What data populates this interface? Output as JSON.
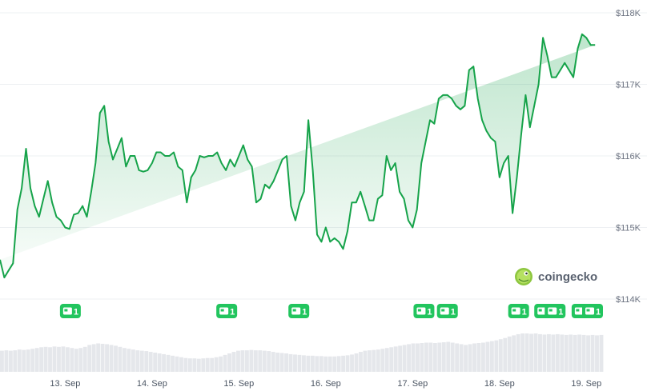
{
  "chart_data": {
    "type": "area",
    "ylim": [
      114000,
      118000
    ],
    "y_ticks": [
      {
        "value": 118000,
        "label": "$118K"
      },
      {
        "value": 117000,
        "label": "$117K"
      },
      {
        "value": 116000,
        "label": "$116K"
      },
      {
        "value": 115000,
        "label": "$115K"
      },
      {
        "value": 114000,
        "label": "$114K"
      }
    ],
    "x_ticks": [
      "13. Sep",
      "14. Sep",
      "15. Sep",
      "16. Sep",
      "17. Sep",
      "18. Sep",
      "19. Sep"
    ],
    "x_tick_days": [
      13,
      14,
      15,
      16,
      17,
      18,
      19
    ],
    "x_range_days": [
      12.25,
      19.2
    ],
    "grid": true,
    "colors": {
      "line": "#16a34a",
      "area": "#16a34a",
      "volume": "#e5e7eb",
      "badge": "#22c55e"
    },
    "series": [
      {
        "x_days": [
          12.25,
          12.3,
          12.35,
          12.4,
          12.45,
          12.5,
          12.55,
          12.6,
          12.65,
          12.7,
          12.75,
          12.8,
          12.85,
          12.9,
          12.95,
          13.0,
          13.05,
          13.1,
          13.15,
          13.2,
          13.25,
          13.3,
          13.35,
          13.4,
          13.45,
          13.5,
          13.55,
          13.6,
          13.65,
          13.7,
          13.75,
          13.8,
          13.85,
          13.9,
          13.95,
          14.0,
          14.05,
          14.1,
          14.15,
          14.2,
          14.25,
          14.3,
          14.35,
          14.4,
          14.45,
          14.5,
          14.55,
          14.6,
          14.65,
          14.7,
          14.75,
          14.8,
          14.85,
          14.9,
          14.95,
          15.0,
          15.05,
          15.1,
          15.15,
          15.2,
          15.25,
          15.3,
          15.35,
          15.4,
          15.45,
          15.5,
          15.55,
          15.6,
          15.65,
          15.7,
          15.75,
          15.8,
          15.85,
          15.9,
          15.95,
          16.0,
          16.05,
          16.1,
          16.15,
          16.2,
          16.25,
          16.3,
          16.35,
          16.4,
          16.45,
          16.5,
          16.55,
          16.6,
          16.65,
          16.7,
          16.75,
          16.8,
          16.85,
          16.9,
          16.95,
          17.0,
          17.05,
          17.1,
          17.15,
          17.2,
          17.25,
          17.3,
          17.35,
          17.4,
          17.45,
          17.5,
          17.55,
          17.6,
          17.65,
          17.7,
          17.75,
          17.8,
          17.85,
          17.9,
          17.95,
          18.0,
          18.05,
          18.1,
          18.15,
          18.2,
          18.25,
          18.3,
          18.35,
          18.4,
          18.45,
          18.5,
          18.55,
          18.6,
          18.65,
          18.7,
          18.75,
          18.8,
          18.85,
          18.9,
          18.95,
          19.0,
          19.05,
          19.1,
          19.15,
          19.2
        ],
        "values": [
          114550,
          114300,
          114400,
          114500,
          115250,
          115550,
          116100,
          115550,
          115300,
          115150,
          115400,
          115650,
          115350,
          115150,
          115100,
          115000,
          114980,
          115180,
          115200,
          115300,
          115150,
          115500,
          115900,
          116600,
          116700,
          116200,
          115950,
          116100,
          116250,
          115850,
          116000,
          116000,
          115800,
          115780,
          115800,
          115900,
          116050,
          116050,
          116000,
          116000,
          116050,
          115850,
          115800,
          115350,
          115700,
          115800,
          116000,
          115980,
          116000,
          116000,
          116050,
          115900,
          115800,
          115950,
          115850,
          116000,
          116150,
          115950,
          115850,
          115350,
          115400,
          115600,
          115550,
          115650,
          115800,
          115950,
          116000,
          115300,
          115100,
          115350,
          115500,
          116500,
          115800,
          114900,
          114800,
          115000,
          114800,
          114850,
          114800,
          114700,
          114950,
          115350,
          115350,
          115500,
          115300,
          115100,
          115100,
          115400,
          115450,
          116000,
          115800,
          115900,
          115500,
          115400,
          115100,
          115000,
          115250,
          115900,
          116200,
          116500,
          116450,
          116800,
          116850,
          116850,
          116800,
          116700,
          116650,
          116700,
          117200,
          117250,
          116800,
          116500,
          116350,
          116250,
          116200,
          115700,
          115900,
          116000,
          115200,
          115700,
          116300,
          116850,
          116400,
          116700,
          117000,
          117650,
          117400,
          117100,
          117100,
          117200,
          117300,
          117200,
          117100,
          117500,
          117700,
          117650,
          117550,
          117550
        ]
      }
    ],
    "volume": [
      0.55,
      0.56,
      0.55,
      0.56,
      0.58,
      0.57,
      0.58,
      0.6,
      0.62,
      0.64,
      0.65,
      0.64,
      0.66,
      0.65,
      0.66,
      0.64,
      0.62,
      0.6,
      0.62,
      0.65,
      0.7,
      0.72,
      0.74,
      0.73,
      0.72,
      0.7,
      0.68,
      0.65,
      0.62,
      0.6,
      0.58,
      0.56,
      0.55,
      0.54,
      0.52,
      0.5,
      0.48,
      0.46,
      0.44,
      0.42,
      0.4,
      0.38,
      0.36,
      0.35,
      0.35,
      0.34,
      0.35,
      0.36,
      0.36,
      0.38,
      0.4,
      0.44,
      0.48,
      0.52,
      0.55,
      0.56,
      0.56,
      0.57,
      0.56,
      0.56,
      0.55,
      0.54,
      0.52,
      0.5,
      0.49,
      0.48,
      0.46,
      0.45,
      0.44,
      0.43,
      0.42,
      0.42,
      0.41,
      0.41,
      0.4,
      0.4,
      0.4,
      0.41,
      0.42,
      0.43,
      0.45,
      0.48,
      0.52,
      0.55,
      0.56,
      0.57,
      0.58,
      0.6,
      0.62,
      0.64,
      0.66,
      0.68,
      0.7,
      0.72,
      0.74,
      0.74,
      0.75,
      0.76,
      0.76,
      0.75,
      0.76,
      0.77,
      0.78,
      0.76,
      0.74,
      0.72,
      0.7,
      0.72,
      0.74,
      0.75,
      0.76,
      0.78,
      0.8,
      0.82,
      0.85,
      0.88,
      0.92,
      0.95,
      0.98,
      1.0,
      1.0,
      0.99,
      1.0,
      0.98,
      0.97,
      0.98,
      0.97,
      0.98,
      0.97,
      0.96,
      0.97,
      0.96,
      0.97,
      0.96,
      0.95,
      0.96,
      0.95,
      0.96
    ],
    "events": [
      {
        "day": 13.06,
        "count": "1"
      },
      {
        "day": 14.86,
        "count": "1"
      },
      {
        "day": 15.69,
        "count": "1"
      },
      {
        "day": 17.13,
        "count": "1"
      },
      {
        "day": 17.4,
        "count": "1"
      },
      {
        "day": 18.22,
        "count": "1"
      },
      {
        "day": 18.52,
        "count": "1"
      },
      {
        "day": 18.64,
        "count": "1"
      },
      {
        "day": 18.95,
        "count": "1"
      },
      {
        "day": 19.2,
        "count": "1"
      }
    ]
  },
  "watermark": {
    "text": "coingecko",
    "icon": "gecko-icon"
  }
}
